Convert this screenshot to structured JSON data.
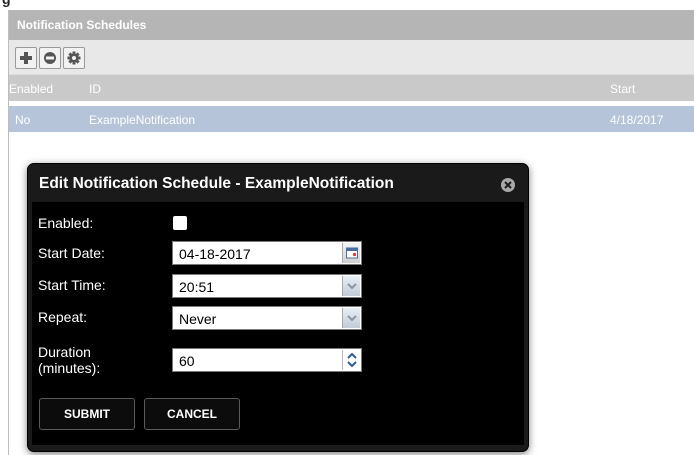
{
  "top_partial_heading": "g",
  "panel": {
    "title": "Notification Schedules",
    "toolbar": {
      "buttons": [
        {
          "name": "add-button",
          "icon": "plus-icon"
        },
        {
          "name": "remove-button",
          "icon": "minus-circle-icon"
        },
        {
          "name": "settings-button",
          "icon": "gear-icon"
        }
      ]
    },
    "table": {
      "columns": [
        "Enabled",
        "ID",
        "Start"
      ],
      "rows": [
        {
          "enabled": "No",
          "id": "ExampleNotification",
          "start": "4/18/2017"
        }
      ]
    }
  },
  "dialog": {
    "title": "Edit Notification Schedule - ExampleNotification",
    "close_icon": "close-icon",
    "fields": {
      "enabled": {
        "label": "Enabled:",
        "checked": false
      },
      "start_date": {
        "label": "Start Date:",
        "value": "04-18-2017",
        "icon": "calendar-icon"
      },
      "start_time": {
        "label": "Start Time:",
        "value": "20:51",
        "icon": "chevron-down-icon"
      },
      "repeat": {
        "label": "Repeat:",
        "value": "Never",
        "icon": "chevron-down-icon"
      },
      "duration": {
        "label_line1": "Duration",
        "label_line2": "(minutes):",
        "value": "60",
        "icon": "spinner-icon"
      }
    },
    "submit_label": "SUBMIT",
    "cancel_label": "CANCEL"
  },
  "colors": {
    "header_gray": "#b5b5b5",
    "selected_row": "#b5c4d9",
    "dialog_bg": "#000000"
  }
}
